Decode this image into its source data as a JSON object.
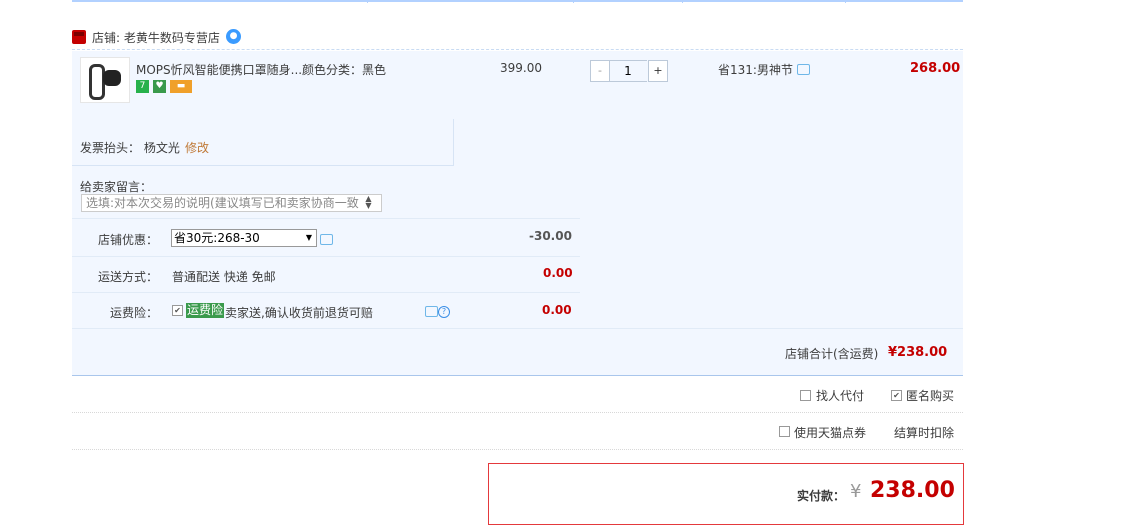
{
  "shop": {
    "label": "店铺: 老黄牛数码专营店"
  },
  "item": {
    "title": "MOPS忻风智能便携口罩随身...",
    "sku": "颜色分类：黑色",
    "price": "399.00",
    "quantity": "1",
    "qty_minus": "-",
    "qty_plus": "+",
    "promo": "省131:男神节",
    "subtotal": "268.00",
    "badges": [
      "7",
      "♥",
      "▬"
    ]
  },
  "invoice": {
    "label": "发票抬头：",
    "name": "杨文光",
    "modify": "修改"
  },
  "message": {
    "label": "给卖家留言：",
    "placeholder": "选填:对本次交易的说明(建议填写已和卖家协商一致"
  },
  "discount": {
    "label": "店铺优惠：",
    "selected": "省30元:268-30",
    "amount": "-30.00"
  },
  "shipping": {
    "label": "运送方式：",
    "method": "普通配送 快递 免邮",
    "amount": "0.00"
  },
  "insurance": {
    "label": "运费险：",
    "tag": "运费险",
    "text": "卖家送,确认收货前退货可赔",
    "amount": "0.00"
  },
  "shop_total": {
    "label": "店铺合计(含运费)",
    "value": "¥238.00"
  },
  "options": {
    "proxy_label": "找人代付",
    "anonymous_label": "匿名购买",
    "tmall_points_label": "使用天猫点券",
    "settle_label": "结算时扣除"
  },
  "payment": {
    "label": "实付款：",
    "currency": "¥",
    "value": "238.00"
  },
  "colors": {
    "accent": "#c40000",
    "panel": "#f2f7ff",
    "highlight": "#3a9a4c"
  }
}
